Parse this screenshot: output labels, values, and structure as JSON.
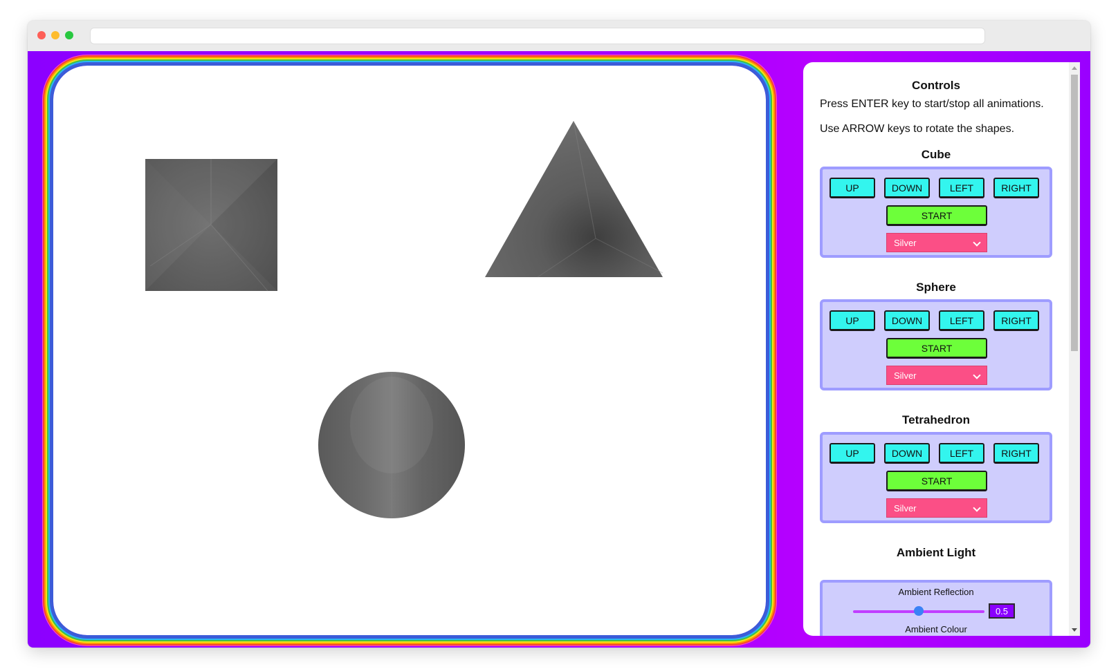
{
  "browser": {
    "url": ""
  },
  "scene": {
    "shapes": [
      {
        "name": "cube",
        "kind": "square",
        "material": "Silver"
      },
      {
        "name": "tetrahedron",
        "kind": "triangle",
        "material": "Silver"
      },
      {
        "name": "sphere",
        "kind": "circle",
        "material": "Silver"
      }
    ]
  },
  "controls": {
    "title": "Controls",
    "instruction_enter": "Press ENTER key to start/stop all animations.",
    "instruction_arrows": "Use ARROW keys to rotate the shapes.",
    "sections": [
      {
        "title": "Cube",
        "up": "UP",
        "down": "DOWN",
        "left": "LEFT",
        "right": "RIGHT",
        "start": "START",
        "material": "Silver"
      },
      {
        "title": "Sphere",
        "up": "UP",
        "down": "DOWN",
        "left": "LEFT",
        "right": "RIGHT",
        "start": "START",
        "material": "Silver"
      },
      {
        "title": "Tetrahedron",
        "up": "UP",
        "down": "DOWN",
        "left": "LEFT",
        "right": "RIGHT",
        "start": "START",
        "material": "Silver"
      }
    ],
    "ambient": {
      "title": "Ambient Light",
      "reflection_label": "Ambient Reflection",
      "reflection_value": "0.5",
      "reflection_fraction": 0.5,
      "colour_label": "Ambient Colour"
    }
  },
  "colors": {
    "background": "#a600ff",
    "button": "#33f5ee",
    "start_button": "#6dff3a",
    "select": "#fb4f86",
    "group": "#cfcdfd"
  }
}
